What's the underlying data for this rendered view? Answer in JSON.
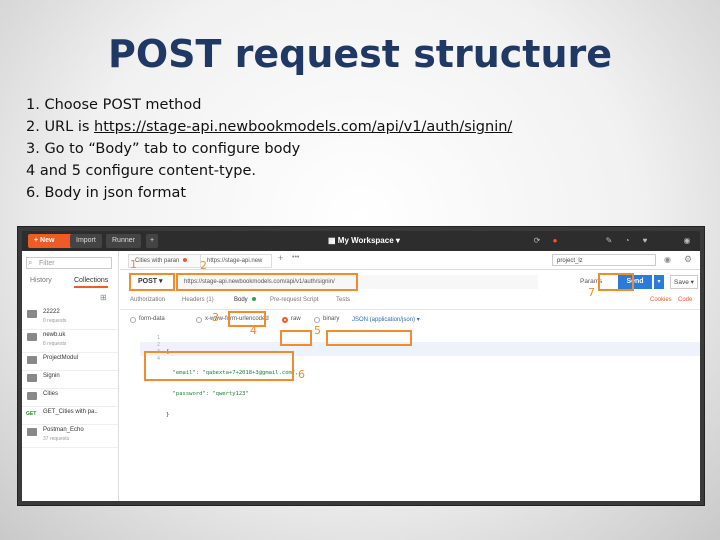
{
  "slide": {
    "title": "POST request structure",
    "steps": [
      "1.  Choose POST method",
      "2.  URL is ",
      "3.  Go to “Body” tab to configure body",
      "4 and 5 configure content-type.",
      "6.  Body in json format"
    ],
    "url_link": "https://stage-api.newbookmodels.com/api/v1/auth/signin/"
  },
  "app": {
    "topbar": {
      "new": "New",
      "import": "Import",
      "runner": "Runner",
      "plus": "+",
      "workspace": "My Workspace ▾",
      "icons": [
        "sync-icon",
        "satellite-icon",
        "wrench-icon",
        "bell-icon",
        "heart-icon"
      ]
    },
    "sidebar": {
      "filter_placeholder": "Filter",
      "tabs": [
        "History",
        "Collections"
      ],
      "items": [
        {
          "name": "22222",
          "sub": "0 requests"
        },
        {
          "name": "newb.uk",
          "sub": "8 requests"
        },
        {
          "name": "ProjectModul",
          "sub": ""
        },
        {
          "name": "Signin",
          "sub": ""
        },
        {
          "name": "Cities",
          "sub": ""
        },
        {
          "method": "GET",
          "name": "GET_Cities with pa..",
          "sub": ""
        },
        {
          "name": "Postman_Echo",
          "sub": "37 requests"
        }
      ]
    },
    "request_tabs": [
      "Cities with paran",
      "https://stage-api.new"
    ],
    "environment": "project_lz",
    "method": "POST ▾",
    "url": "https://stage-api.newbookmodels.com/api/v1/auth/signin/",
    "params": "Params",
    "send": "Send",
    "send_arrow": "▾",
    "save": "Save ▾",
    "req_tabs": {
      "authorization": "Authorization",
      "headers": "Headers (1)",
      "body": "Body",
      "prescript": "Pre-request Script",
      "tests": "Tests",
      "cookies": "Cookies",
      "code": "Code"
    },
    "body_options": {
      "none": "form-data",
      "urlencoded": "x-www-form-urlencoded",
      "raw": "raw",
      "binary": "binary",
      "content_type": "JSON (application/json) ▾"
    },
    "editor": {
      "lines": [
        "1",
        "2",
        "3",
        "4"
      ],
      "code": [
        "{",
        "  \"email\": \"qabexta+7+2018+3@gmail.com\",",
        "  \"password\": \"qwerty123\"",
        "}"
      ]
    }
  },
  "annotations": [
    "1",
    "2",
    "3",
    "4",
    "5",
    "6",
    "7"
  ],
  "colors": {
    "title": "#1f3864",
    "highlight": "#f08c2e",
    "send": "#2b7bd8",
    "accent": "#ef5b25"
  }
}
